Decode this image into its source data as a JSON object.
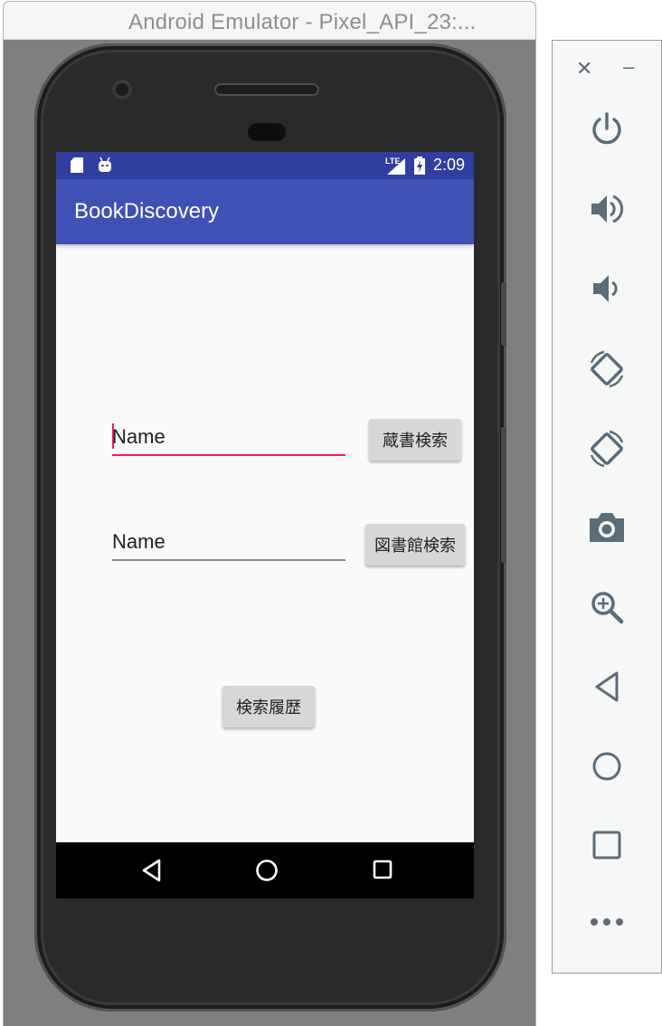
{
  "window": {
    "title": "Android Emulator - Pixel_API_23:..."
  },
  "statusbar": {
    "time": "2:09",
    "network": "LTE"
  },
  "app": {
    "title": "BookDiscovery"
  },
  "form": {
    "field1_text": "Name",
    "button1_label": "蔵書検索",
    "field2_text": "Name",
    "button2_label": "図書館検索",
    "history_label": "検索履歴"
  },
  "colors": {
    "primary": "#3f51b5",
    "primary_dark": "#303f9f",
    "accent": "#e91e63",
    "panel_icon": "#5a6d79"
  },
  "panel": {
    "tools": [
      "power-icon",
      "volume-up-icon",
      "volume-down-icon",
      "rotate-left-icon",
      "rotate-right-icon",
      "camera-icon",
      "zoom-icon",
      "back-icon",
      "home-icon",
      "overview-icon",
      "more-icon"
    ]
  }
}
